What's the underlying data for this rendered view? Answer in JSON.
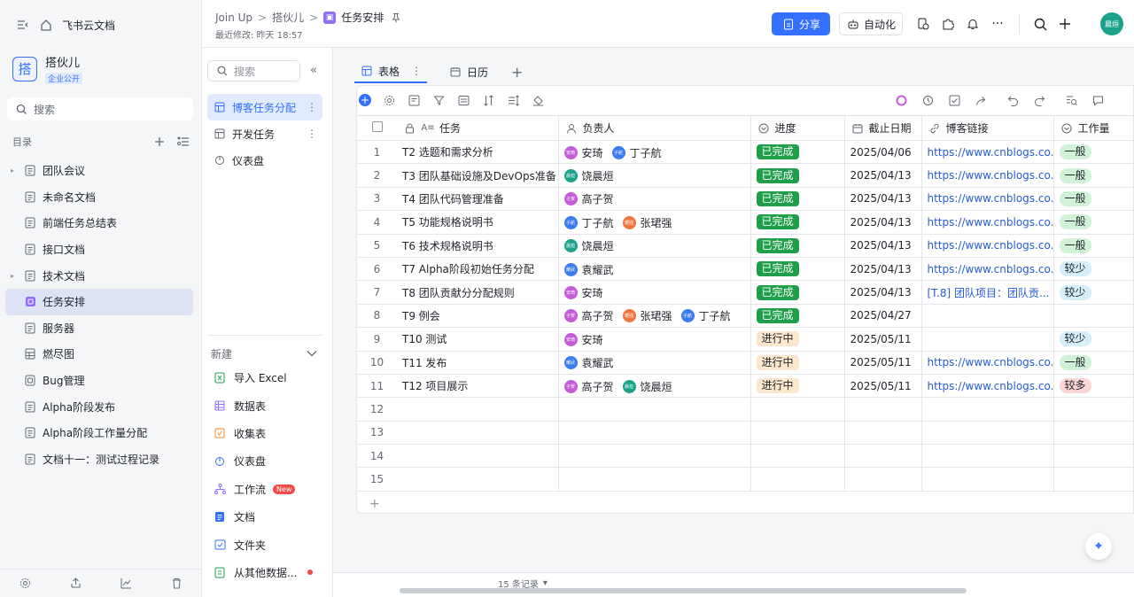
{
  "sidebar": {
    "brand": "飞书云文档",
    "space_name": "搭伙儿",
    "space_avatar": "搭",
    "space_tag": "企业公开",
    "search_label": "搜索",
    "toc_label": "目录",
    "items": [
      {
        "label": "团队会议",
        "caret": "▸"
      },
      {
        "label": "未命名文档",
        "caret": ""
      },
      {
        "label": "前端任务总结表",
        "caret": ""
      },
      {
        "label": "接口文档",
        "caret": ""
      },
      {
        "label": "技术文档",
        "caret": "▸"
      },
      {
        "label": "任务安排",
        "caret": ""
      },
      {
        "label": "服务器",
        "caret": ""
      },
      {
        "label": "燃尽图",
        "caret": ""
      },
      {
        "label": "Bug管理",
        "caret": ""
      },
      {
        "label": "Alpha阶段发布",
        "caret": ""
      },
      {
        "label": "Alpha阶段工作量分配",
        "caret": ""
      },
      {
        "label": "文档十一：测试过程记录",
        "caret": ""
      }
    ]
  },
  "header": {
    "crumb1": "Join Up",
    "crumb2": "搭伙儿",
    "crumb3": "任务安排",
    "modified": "最近修改: 昨天 18:57",
    "share_label": "分享",
    "auto_label": "自动化",
    "user_initials": "晨烜"
  },
  "views": {
    "search_placeholder": "搜索",
    "items": [
      {
        "label": "博客任务分配"
      },
      {
        "label": "开发任务"
      },
      {
        "label": "仪表盘"
      }
    ],
    "new_label": "新建",
    "new_items": [
      {
        "label": "导入 Excel"
      },
      {
        "label": "数据表"
      },
      {
        "label": "收集表"
      },
      {
        "label": "仪表盘"
      },
      {
        "label": "工作流",
        "badge": "New"
      },
      {
        "label": "文档"
      },
      {
        "label": "文件夹"
      },
      {
        "label": "从其他数据..."
      }
    ]
  },
  "tabs": [
    {
      "label": "表格"
    },
    {
      "label": "日历"
    }
  ],
  "table": {
    "columns": [
      "任务",
      "负责人",
      "进度",
      "截止日期",
      "博客链接",
      "工作量"
    ],
    "rows": [
      {
        "idx": "1",
        "task": "T2 选题和需求分析",
        "people": [
          {
            "name": "安琦",
            "ini": "安琦",
            "color": "#c55dd8"
          },
          {
            "name": "丁子航",
            "ini": "子航",
            "color": "#3d7bf0"
          }
        ],
        "status": "已完成",
        "st": "done",
        "date": "2025/04/06",
        "link": "https://www.cnblogs.co...",
        "wl": "一般",
        "wlc": "normal"
      },
      {
        "idx": "2",
        "task": "T3 团队基础设施及DevOps准备",
        "people": [
          {
            "name": "饶晨烜",
            "ini": "晨烜",
            "color": "#1aa38a"
          }
        ],
        "status": "已完成",
        "st": "done",
        "date": "2025/04/13",
        "link": "https://www.cnblogs.co...",
        "wl": "一般",
        "wlc": "normal"
      },
      {
        "idx": "3",
        "task": "T4 团队代码管理准备",
        "people": [
          {
            "name": "高子贺",
            "ini": "子贺",
            "color": "#c55dd8"
          }
        ],
        "status": "已完成",
        "st": "done",
        "date": "2025/04/13",
        "link": "https://www.cnblogs.co...",
        "wl": "一般",
        "wlc": "normal"
      },
      {
        "idx": "4",
        "task": "T5 功能规格说明书",
        "people": [
          {
            "name": "丁子航",
            "ini": "子航",
            "color": "#3d7bf0"
          },
          {
            "name": "张珺强",
            "ini": "珺强",
            "color": "#f0763d"
          }
        ],
        "status": "已完成",
        "st": "done",
        "date": "2025/04/13",
        "link": "https://www.cnblogs.co...",
        "wl": "一般",
        "wlc": "normal"
      },
      {
        "idx": "5",
        "task": "T6 技术规格说明书",
        "people": [
          {
            "name": "饶晨烜",
            "ini": "晨烜",
            "color": "#1aa38a"
          }
        ],
        "status": "已完成",
        "st": "done",
        "date": "2025/04/13",
        "link": "https://www.cnblogs.co...",
        "wl": "一般",
        "wlc": "normal"
      },
      {
        "idx": "6",
        "task": "T7 Alpha阶段初始任务分配",
        "people": [
          {
            "name": "袁耀武",
            "ini": "耀武",
            "color": "#3d7bf0"
          }
        ],
        "status": "已完成",
        "st": "done",
        "date": "2025/04/13",
        "link": "https://www.cnblogs.co...",
        "wl": "较少",
        "wlc": "less"
      },
      {
        "idx": "7",
        "task": "T8 团队贡献分分配规则",
        "people": [
          {
            "name": "安琦",
            "ini": "安琦",
            "color": "#c55dd8"
          }
        ],
        "status": "已完成",
        "st": "done",
        "date": "2025/04/13",
        "link": "[T.8] 团队项目：团队贡...",
        "wl": "较少",
        "wlc": "less"
      },
      {
        "idx": "8",
        "task": "T9 例会",
        "people": [
          {
            "name": "高子贺",
            "ini": "子贺",
            "color": "#c55dd8"
          },
          {
            "name": "张珺强",
            "ini": "珺强",
            "color": "#f0763d"
          },
          {
            "name": "丁子航",
            "ini": "子航",
            "color": "#3d7bf0"
          }
        ],
        "status": "已完成",
        "st": "done",
        "date": "2025/04/27",
        "link": "",
        "wl": "",
        "wlc": ""
      },
      {
        "idx": "9",
        "task": "T10 测试",
        "people": [
          {
            "name": "安琦",
            "ini": "安琦",
            "color": "#c55dd8"
          }
        ],
        "status": "进行中",
        "st": "doing",
        "date": "2025/05/11",
        "link": "",
        "wl": "较少",
        "wlc": "less"
      },
      {
        "idx": "10",
        "task": "T11 发布",
        "people": [
          {
            "name": "袁耀武",
            "ini": "耀武",
            "color": "#3d7bf0"
          }
        ],
        "status": "进行中",
        "st": "doing",
        "date": "2025/05/11",
        "link": "https://www.cnblogs.co...",
        "wl": "一般",
        "wlc": "normal"
      },
      {
        "idx": "11",
        "task": "T12 项目展示",
        "people": [
          {
            "name": "高子贺",
            "ini": "子贺",
            "color": "#c55dd8"
          },
          {
            "name": "饶晨烜",
            "ini": "晨烜",
            "color": "#1aa38a"
          }
        ],
        "status": "进行中",
        "st": "doing",
        "date": "2025/05/11",
        "link": "https://www.cnblogs.co...",
        "wl": "较多",
        "wlc": "more"
      },
      {
        "idx": "12",
        "task": "",
        "people": [],
        "status": "",
        "st": "",
        "date": "",
        "link": "",
        "wl": "",
        "wlc": ""
      },
      {
        "idx": "13",
        "task": "",
        "people": [],
        "status": "",
        "st": "",
        "date": "",
        "link": "",
        "wl": "",
        "wlc": ""
      },
      {
        "idx": "14",
        "task": "",
        "people": [],
        "status": "",
        "st": "",
        "date": "",
        "link": "",
        "wl": "",
        "wlc": ""
      },
      {
        "idx": "15",
        "task": "",
        "people": [],
        "status": "",
        "st": "",
        "date": "",
        "link": "",
        "wl": "",
        "wlc": ""
      }
    ]
  },
  "footer": {
    "records": "15 条记录"
  },
  "colors": {
    "accent": "#3370ff",
    "done": "#1f9f4a",
    "doing": "#fde7cf"
  }
}
